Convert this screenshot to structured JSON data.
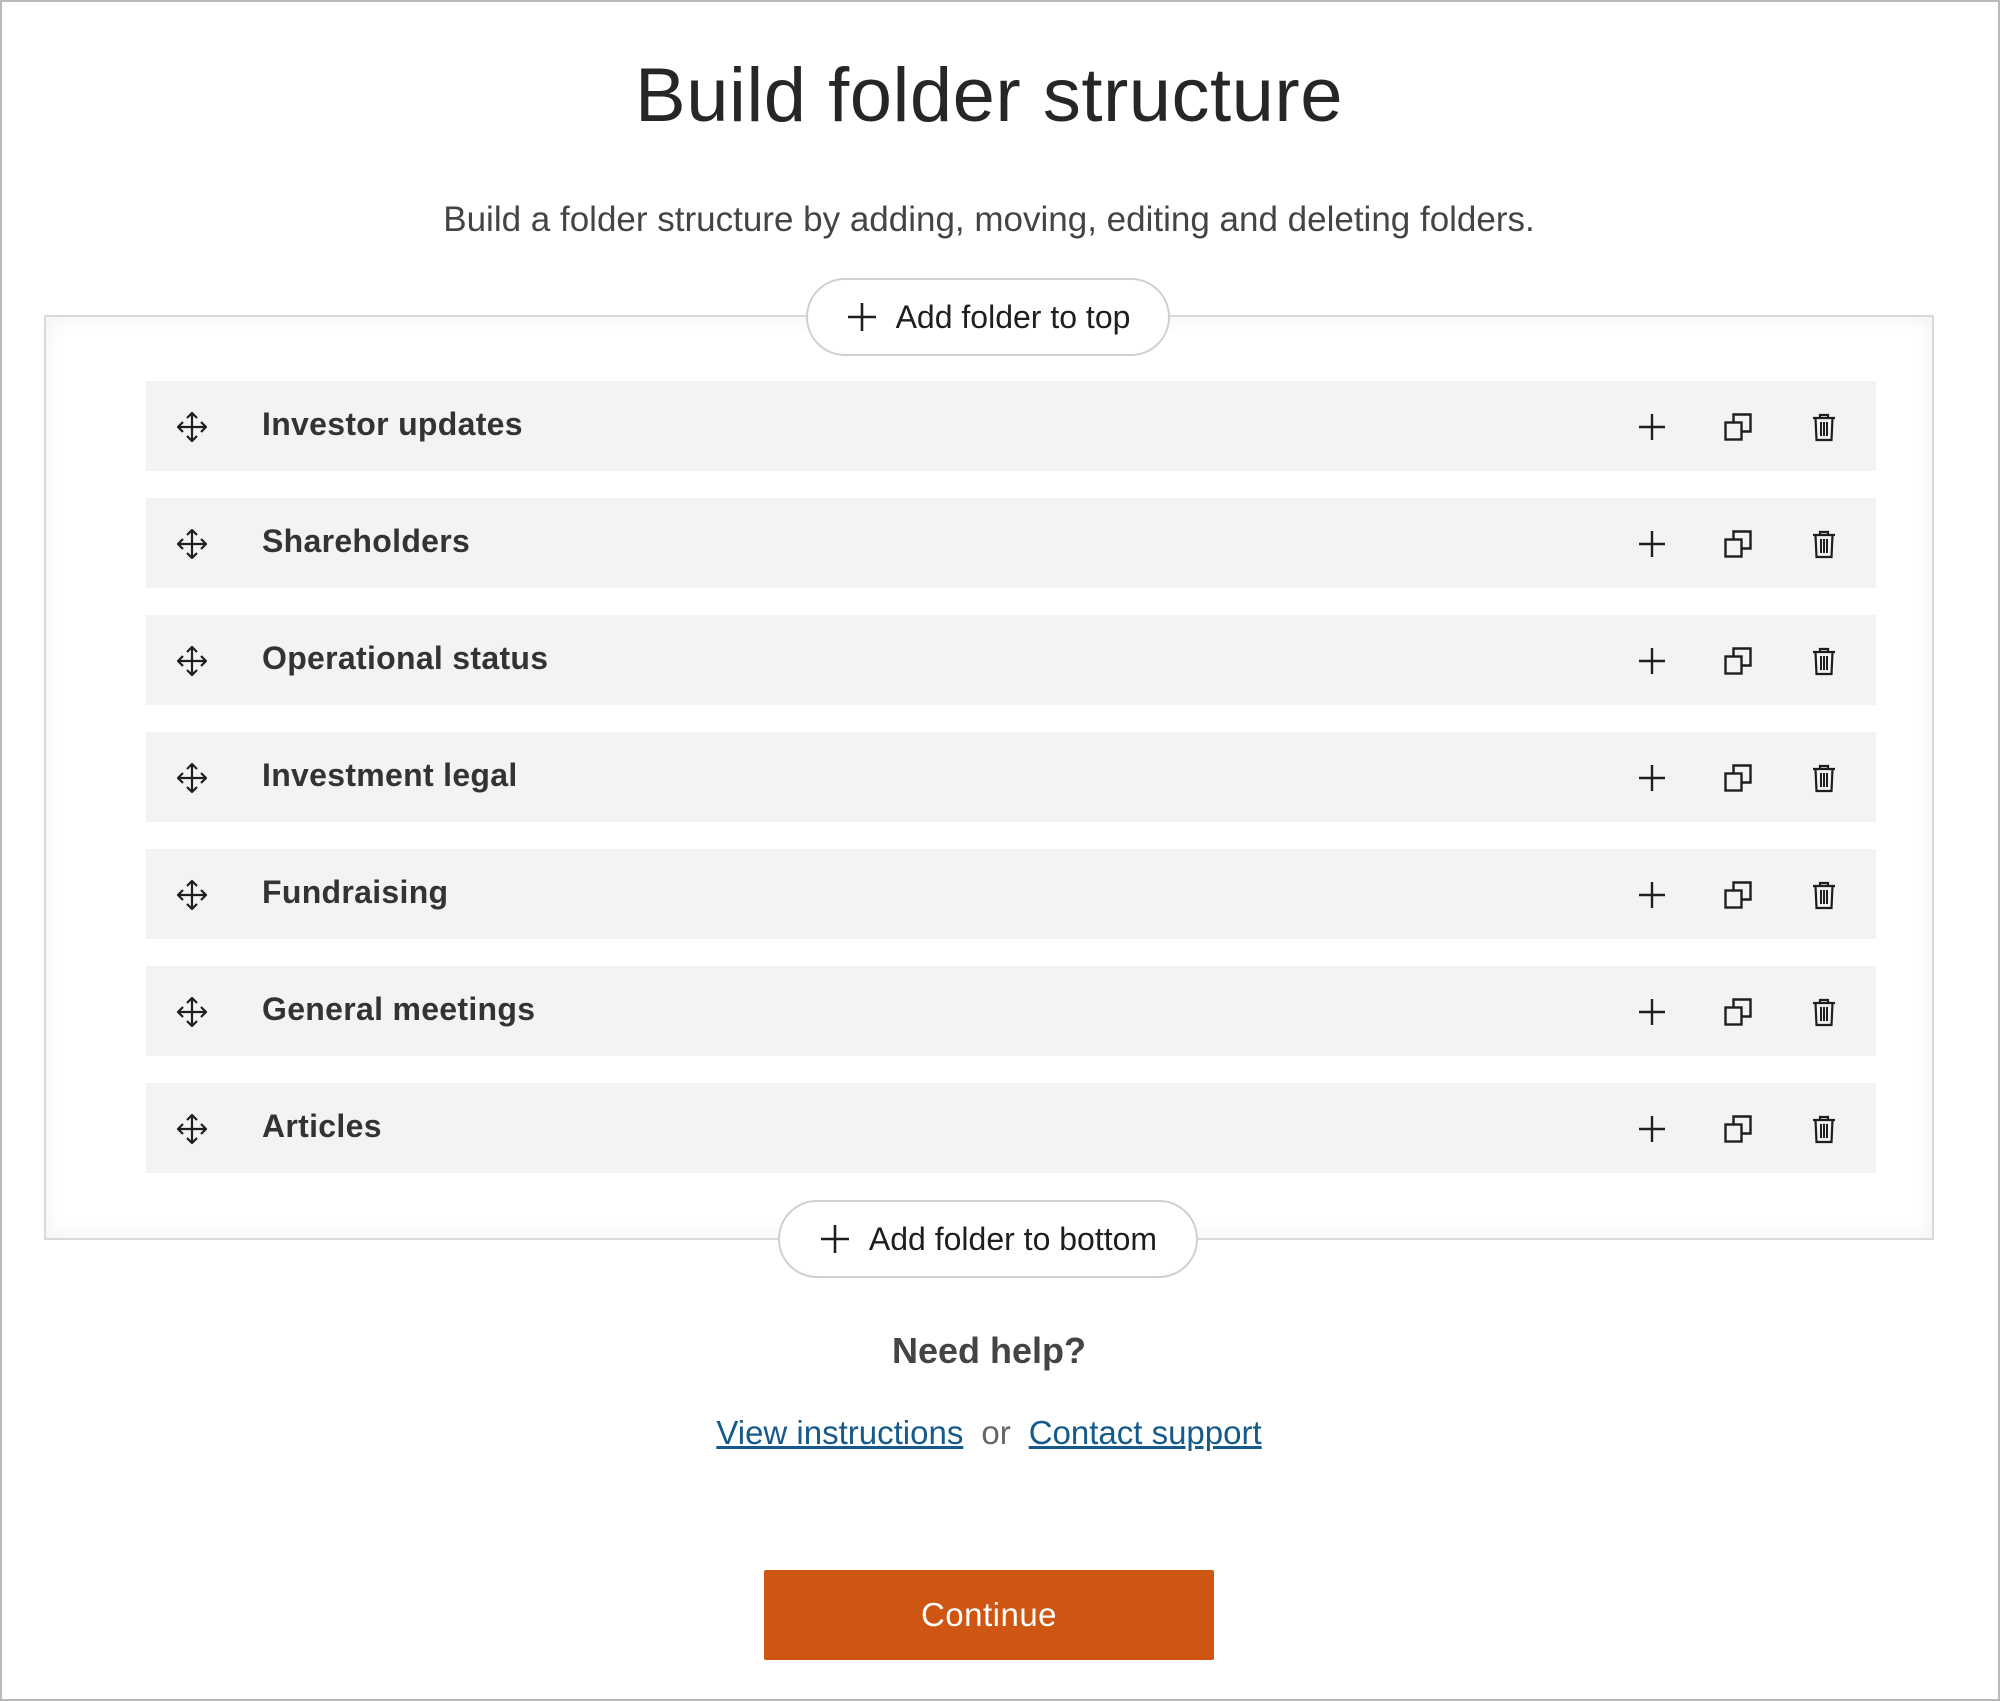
{
  "page": {
    "title": "Build folder structure",
    "subtitle": "Build a folder structure by adding, moving, editing and deleting folders."
  },
  "buttons": {
    "add_top": "Add folder to top",
    "add_bottom": "Add folder to bottom",
    "continue": "Continue"
  },
  "folders": [
    {
      "label": "Investor updates"
    },
    {
      "label": "Shareholders"
    },
    {
      "label": "Operational status"
    },
    {
      "label": "Investment legal"
    },
    {
      "label": "Fundraising"
    },
    {
      "label": "General meetings"
    },
    {
      "label": "Articles"
    }
  ],
  "help": {
    "title": "Need help?",
    "view_instructions": "View instructions",
    "or": "or",
    "contact_support": "Contact support"
  },
  "icons": {
    "drag": "move-arrows-icon",
    "add": "plus-icon",
    "duplicate": "duplicate-icon",
    "delete": "trash-icon"
  },
  "colors": {
    "accent": "#cf5512",
    "link": "#155a8a",
    "row_bg": "#f4f3f1"
  }
}
